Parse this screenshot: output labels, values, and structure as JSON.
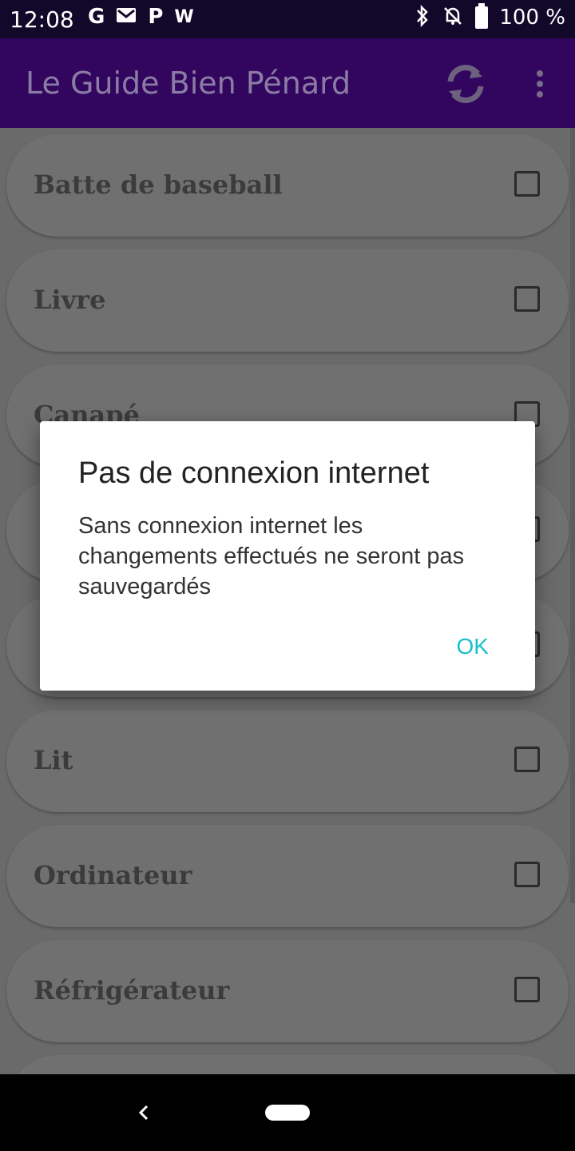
{
  "status_bar": {
    "time": "12:08",
    "notification_icons": [
      "G",
      "mail-icon",
      "P",
      "W"
    ],
    "battery_text": "100 %",
    "right_icons": [
      "bluetooth-icon",
      "bell-off-icon",
      "battery-icon"
    ]
  },
  "app_bar": {
    "title": "Le Guide Bien Pénard",
    "actions": [
      "refresh-icon",
      "overflow-menu-icon"
    ],
    "color": "#32065e"
  },
  "list": {
    "items": [
      {
        "label": "Batte de baseball",
        "checked": false
      },
      {
        "label": "Livre",
        "checked": false
      },
      {
        "label": "Canapé",
        "checked": false
      },
      {
        "label": "",
        "checked": false
      },
      {
        "label": "",
        "checked": false
      },
      {
        "label": "Lit",
        "checked": false
      },
      {
        "label": "Ordinateur",
        "checked": false
      },
      {
        "label": "Réfrigérateur",
        "checked": false
      },
      {
        "label": "",
        "checked": false
      }
    ]
  },
  "dialog": {
    "title": "Pas de connexion internet",
    "message": "Sans connexion internet les changements effectués ne seront pas sauvegardés",
    "ok_label": "OK",
    "accent": "#17c1c9"
  }
}
